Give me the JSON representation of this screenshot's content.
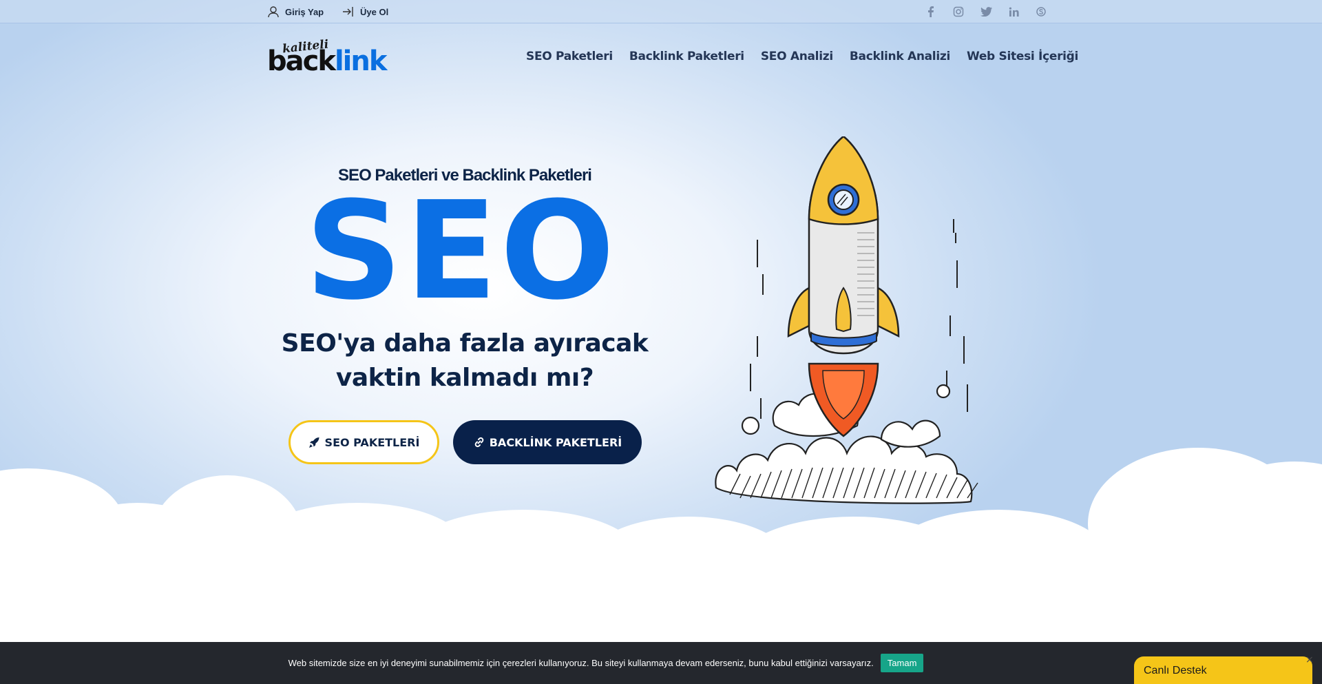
{
  "topbar": {
    "login_label": "Giriş Yap",
    "register_label": "Üye Ol",
    "socials": [
      "facebook-icon",
      "instagram-icon",
      "twitter-icon",
      "linkedin-icon",
      "skype-icon"
    ]
  },
  "logo": {
    "script": "kaliteli",
    "word_dark": "back",
    "word_blue": "link"
  },
  "nav": {
    "items": [
      "SEO Paketleri",
      "Backlink Paketleri",
      "SEO Analizi",
      "Backlink Analizi",
      "Web Sitesi İçeriği"
    ]
  },
  "hero": {
    "subtitle": "SEO Paketleri ve Backlink Paketleri",
    "big_word": "SEO",
    "question_line1": "SEO'ya daha fazla ayıracak",
    "question_line2": "vaktin kalmadı mı?",
    "btn_seo": "SEO PAKETLERİ",
    "btn_backlink": "BACKLİNK PAKETLERİ"
  },
  "cookie": {
    "message": "Web sitemizde size en iyi deneyimi sunabilmemiz için çerezleri kullanıyoruz. Bu siteyi kullanmaya devam ederseniz, bunu kabul ettiğinizi varsayarız.",
    "ok_label": "Tamam"
  },
  "live_support": {
    "label": "Canlı Destek",
    "close": "×"
  },
  "colors": {
    "brand_blue": "#0b6fe4",
    "navy": "#09214a",
    "yellow": "#f5c518",
    "teal": "#17a589"
  }
}
